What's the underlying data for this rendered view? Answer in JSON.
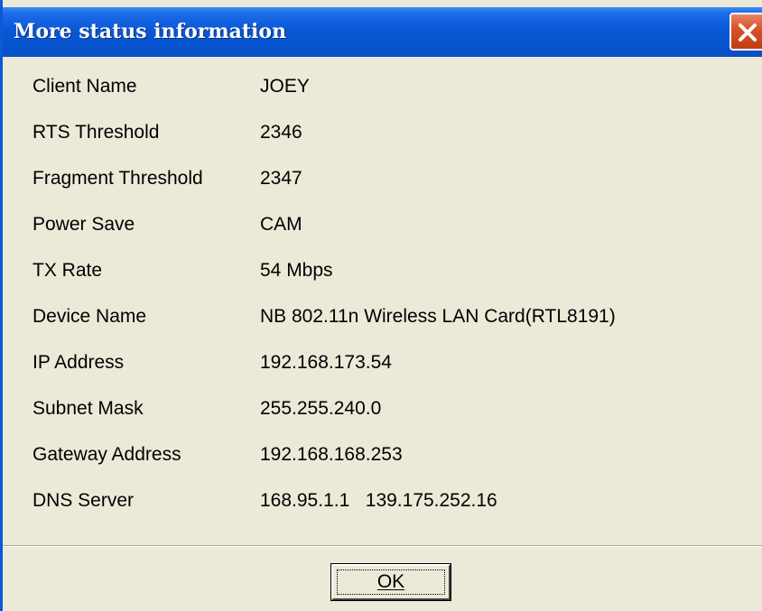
{
  "window": {
    "title": "More status information",
    "close_icon": "close-icon",
    "colors": {
      "titlebar": "#0a58d6",
      "body": "#ece9d8",
      "close_button": "#d9542b"
    }
  },
  "info": {
    "rows": [
      {
        "label": "Client Name",
        "value": "JOEY"
      },
      {
        "label": "RTS Threshold",
        "value": "2346"
      },
      {
        "label": "Fragment Threshold",
        "value": "2347"
      },
      {
        "label": "Power Save",
        "value": "CAM"
      },
      {
        "label": "TX Rate",
        "value": "54 Mbps"
      },
      {
        "label": "Device Name",
        "value": "NB 802.11n Wireless LAN Card(RTL8191)"
      },
      {
        "label": "IP Address",
        "value": "192.168.173.54"
      },
      {
        "label": "Subnet Mask",
        "value": "255.255.240.0"
      },
      {
        "label": "Gateway Address",
        "value": "192.168.168.253"
      },
      {
        "label": "DNS Server",
        "value": "168.95.1.1   139.175.252.16"
      }
    ]
  },
  "footer": {
    "ok_label": "OK"
  }
}
